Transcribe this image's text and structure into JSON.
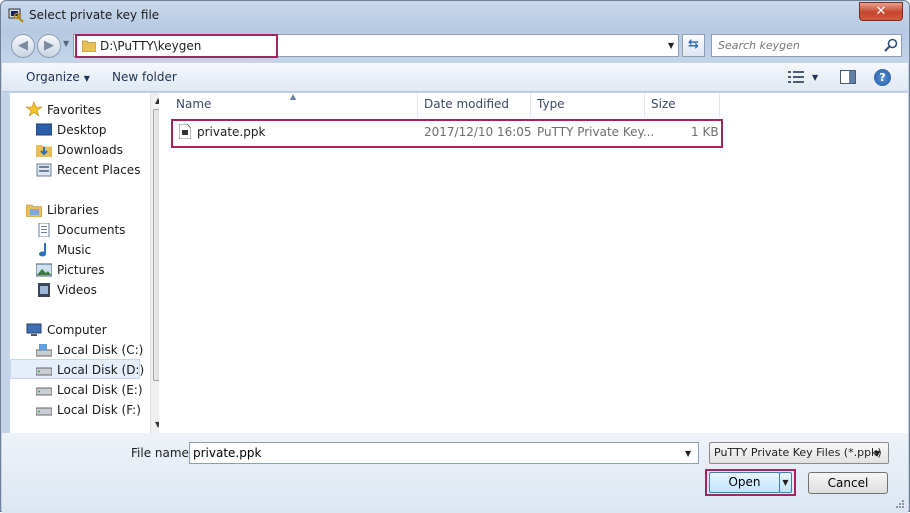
{
  "window": {
    "title": "Select private key file",
    "close_label": "✕"
  },
  "address": {
    "path": "D:\\PuTTY\\keygen"
  },
  "search": {
    "placeholder": "Search keygen"
  },
  "toolbar": {
    "organize_label": "Organize",
    "new_folder_label": "New folder",
    "help_label": "?"
  },
  "sidebar": {
    "favorites": {
      "label": "Favorites",
      "items": [
        "Desktop",
        "Downloads",
        "Recent Places"
      ]
    },
    "libraries": {
      "label": "Libraries",
      "items": [
        "Documents",
        "Music",
        "Pictures",
        "Videos"
      ]
    },
    "computer": {
      "label": "Computer",
      "items": [
        "Local Disk (C:)",
        "Local Disk (D:)",
        "Local Disk (E:)",
        "Local Disk (F:)"
      ]
    },
    "selected": "Local Disk (D:)"
  },
  "columns": [
    "Name",
    "Date modified",
    "Type",
    "Size"
  ],
  "files": [
    {
      "name": "private.ppk",
      "date": "2017/12/10 16:05",
      "type": "PuTTY Private Key...",
      "size": "1 KB"
    }
  ],
  "footer": {
    "file_name_label": "File name:",
    "file_name_value": "private.ppk",
    "file_type": "PuTTY Private Key Files (*.ppk)",
    "open_label": "Open",
    "cancel_label": "Cancel"
  },
  "colors": {
    "highlight": "#a2255b",
    "accent": "#2f6fb7"
  }
}
